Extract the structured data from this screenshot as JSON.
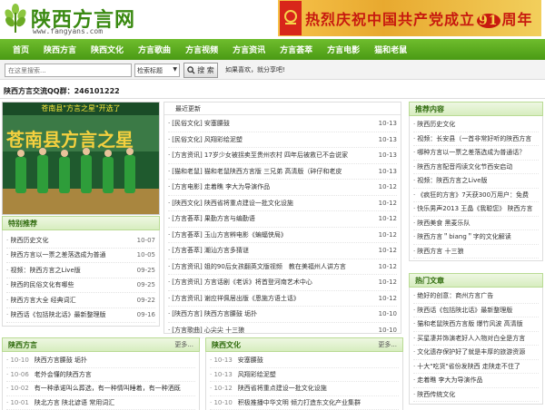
{
  "header": {
    "site_title": "陕西方言网",
    "site_url": "www.fangyans.com",
    "banner_text": "热烈庆祝中国共产党成立",
    "banner_number": "91",
    "banner_suffix": "周年"
  },
  "nav": [
    "首页",
    "陕西方言",
    "陕西文化",
    "方言歌曲",
    "方言视频",
    "方言资讯",
    "方言荟萃",
    "方言电影",
    "猫和老鼠"
  ],
  "search": {
    "placeholder": "在这里搜索...",
    "select_value": "检索标题",
    "button_label": "搜 索",
    "hint": "如果喜欢，就分享吧!"
  },
  "qq": "陕西方言交流QQ群：246101222",
  "photo": {
    "caption": "苍南县\"方言之星\"开选了"
  },
  "special": {
    "title": "特别推荐",
    "items": [
      {
        "t": "陕西历史文化",
        "d": "10-07"
      },
      {
        "t": "陕西方言以一票之差落选成为普通",
        "d": "10-05"
      },
      {
        "t": "视频：陕西方言之Live版",
        "d": "09-25"
      },
      {
        "t": "陕西的民俗文化有哪些",
        "d": "09-25"
      },
      {
        "t": "陕西方言大全 经典词汇",
        "d": "09-22"
      },
      {
        "t": "陕西话《包括陕北话》最新整理版",
        "d": "09-16"
      }
    ]
  },
  "latest": {
    "title": "最近更新",
    "items": [
      {
        "t": "[民俗文化] 安塞腰鼓",
        "d": "10-13"
      },
      {
        "t": "[民俗文化] 风翔彩绘泥塑",
        "d": "10-13"
      },
      {
        "t": "[方言资讯] 17岁少女被拐卖至贵州农村 四年后被救已不会说家",
        "d": "10-13"
      },
      {
        "t": "[猫和老鼠] 猫和老鼠陕西方言版 三兄弟 高清版（碎仔和老皮",
        "d": "10-13"
      },
      {
        "t": "[方言电影] 走着瞧 李大为导演作品",
        "d": "10-12"
      },
      {
        "t": "[陕西文化] 陕西省将重点建设一批文化设施",
        "d": "10-12"
      },
      {
        "t": "[方言荟萃] 果勤方言与编勤语",
        "d": "10-12"
      },
      {
        "t": "[方言荟萃] 玉山方言辨电影《蝙蝠侠局》",
        "d": "10-12"
      },
      {
        "t": "[方言荟萃] 潮汕方言多猜谜",
        "d": "10-12"
      },
      {
        "t": "[方言资讯] 姐的90后女孩翻英文版视频　教在美福州人讲方言",
        "d": "10-12"
      },
      {
        "t": "[方言资讯] 方言话剧《老诉》将首登河南艺术中心",
        "d": "10-12"
      },
      {
        "t": "[方言资讯] 谢应祥佩居出版《恩施方语土话》",
        "d": "10-12"
      },
      {
        "t": "[陕西方言] 陕西方言腰鼓 垢扑",
        "d": "10-10"
      },
      {
        "t": "[方言歌曲] 心尖尖 十三狼",
        "d": "10-10"
      }
    ]
  },
  "recommend": {
    "title": "推荐内容",
    "items": [
      "陕西历史文化",
      "视频：长安县（一首非常好听的陕西方言",
      "哪种方言以一票之差落选成为普通话？",
      "陕西方言配音闯读文化节西安启动",
      "视频：陕西方言之Live版",
      "《疯狂的方言》7天获300万用户：免费",
      "快乐男声2013 王晶《我聪您》 陕西方言",
      "陕西美食 黑麦乐队",
      "陕西方言＂biang＂字的文化解读",
      "陕西方言 十三狼"
    ]
  },
  "hot": {
    "title": "热门文章",
    "items": [
      "绝好的创意：商州方言广告",
      "陕西话《包括陕北话》最新整理版",
      "猫和老鼠陕西方言版 爆竹风波 高清版",
      "买星凄并饰演老好人入物对白全是方言",
      "文化遗存保护好了就是丰厚的旅游资源",
      "十大\"吃货\"省份发陕西 走陕走不住了",
      "走着瞧 李大为导演作品",
      "陕西传统文化"
    ]
  },
  "bottom": [
    {
      "title": "陕西方言",
      "more": "更多...",
      "items": [
        {
          "d": "10-10",
          "t": "陕西方言腰鼓 垢扑"
        },
        {
          "d": "10-06",
          "t": "老外会懂的陕西方言"
        },
        {
          "d": "10-02",
          "t": "有一种承诺叫么葬选，有一种情叫睡着，有一种洒既"
        },
        {
          "d": "10-01",
          "t": "陕北方言 陕北谚语 常用词汇"
        }
      ]
    },
    {
      "title": "陕西文化",
      "more": "更多...",
      "items": [
        {
          "d": "10-13",
          "t": "安塞腰鼓"
        },
        {
          "d": "10-13",
          "t": "风翔彩绘泥塑"
        },
        {
          "d": "10-12",
          "t": "陕西省将重点建设一批文化设施"
        },
        {
          "d": "10-10",
          "t": "积极推播中华文明 倾力打造东文化产业集群"
        }
      ]
    }
  ],
  "colors": {
    "nav_green": "#4a9a14",
    "title_green": "#3a8a12",
    "banner_red": "#c7190f"
  }
}
